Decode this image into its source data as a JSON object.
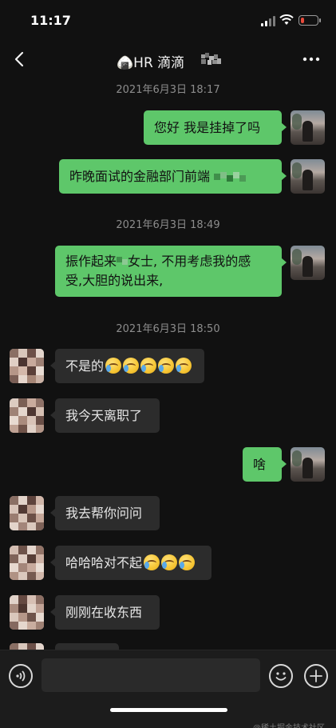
{
  "status_bar": {
    "time": "11:17",
    "battery_level": 0.2,
    "battery_color": "#e84b3c"
  },
  "nav": {
    "title": "🍙HR 滴滴",
    "back_icon": "chevron-left-icon",
    "more_icon": "ellipsis-icon"
  },
  "colors": {
    "background": "#111111",
    "bubble_out": "#5ec76a",
    "bubble_in": "#2c2c2c",
    "timestamp": "#8d8d8d"
  },
  "timestamps": [
    "2021年6月3日 18:17",
    "2021年6月3日 18:49",
    "2021年6月3日 18:50"
  ],
  "messages": [
    {
      "sender": "me",
      "text": "您好 我是挂掉了吗"
    },
    {
      "sender": "me",
      "text": "昨晚面试的金融部门前端",
      "suffix": "pixelated-redaction"
    },
    {
      "sender": "me",
      "line1_a": "振作起来",
      "line1_b": "女士, 不用考虑我的感",
      "line2": "受,大胆的说出来,"
    },
    {
      "sender": "hr",
      "text": "不是的",
      "emoji": [
        "laugh-cry",
        "laugh-cry",
        "laugh-cry",
        "laugh-cry",
        "laugh-cry"
      ]
    },
    {
      "sender": "hr",
      "text": "我今天离职了"
    },
    {
      "sender": "me",
      "text": "啥"
    },
    {
      "sender": "hr",
      "text": "我去帮你问问"
    },
    {
      "sender": "hr",
      "text": "哈哈哈对不起",
      "emoji": [
        "laugh-cry",
        "laugh-cry",
        "laugh-cry"
      ]
    },
    {
      "sender": "hr",
      "text": "刚刚在收东西"
    },
    {
      "sender": "hr",
      "text": ""
    }
  ],
  "input_bar": {
    "voice_icon": "voice-icon",
    "emoji_icon": "smiley-icon",
    "plus_icon": "plus-icon",
    "input_value": ""
  },
  "watermark": "@稀土掘金技术社区"
}
